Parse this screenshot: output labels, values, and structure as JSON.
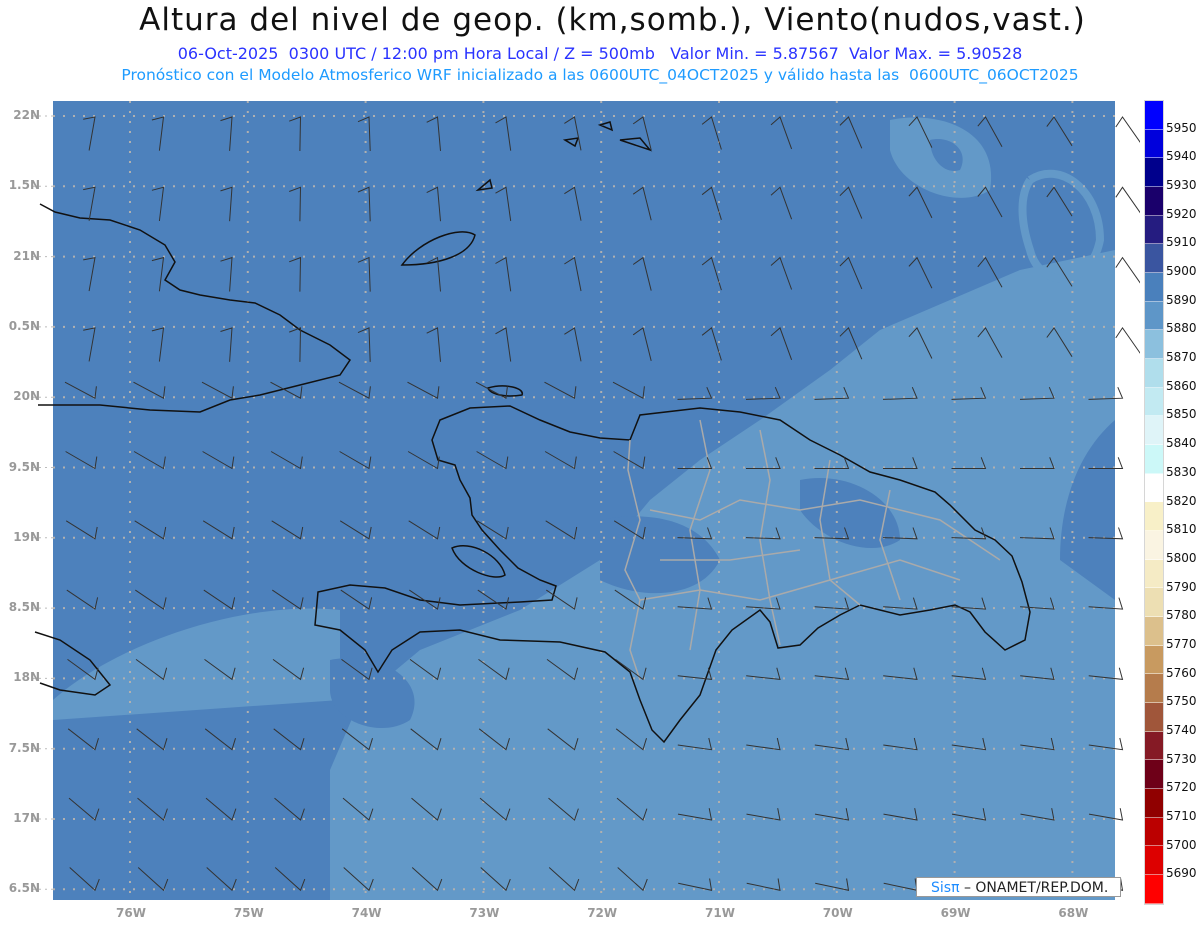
{
  "header": {
    "title": "Altura del nivel de geop. (km,somb.), Viento(nudos,vast.)",
    "line1": "06-Oct-2025  0300 UTC / 12:00 pm Hora Local / Z = 500mb   Valor Min. = 5.87567  Valor Max. = 5.90528",
    "line2": "Pronóstico con el Modelo Atmosferico WRF inicializado a las 0600UTC_04OCT2025 y válido hasta las  0600UTC_06OCT2025"
  },
  "axes": {
    "lat_labels": [
      "22N",
      "1.5N",
      "21N",
      "0.5N",
      "20N",
      "9.5N",
      "19N",
      "8.5N",
      "18N",
      "7.5N",
      "17N",
      "6.5N"
    ],
    "lon_labels": [
      "76W",
      "75W",
      "74W",
      "73W",
      "72W",
      "71W",
      "70W",
      "69W",
      "68W"
    ]
  },
  "colorbar": {
    "labels": [
      "5950",
      "5940",
      "5930",
      "5920",
      "5910",
      "5900",
      "5890",
      "5880",
      "5870",
      "5860",
      "5850",
      "5840",
      "5830",
      "5820",
      "5810",
      "5800",
      "5790",
      "5780",
      "5770",
      "5760",
      "5750",
      "5740",
      "5730",
      "5720",
      "5710",
      "5700",
      "5690"
    ],
    "colors": [
      "#0000ff",
      "#0000dc",
      "#00008c",
      "#1a006b",
      "#251c80",
      "#3a55a0",
      "#4a80bc",
      "#5e96c8",
      "#8cc0de",
      "#b0deec",
      "#c2eaf2",
      "#dff4f8",
      "#ccf8f8",
      "#ffffff",
      "#f8f0c8",
      "#faf4e2",
      "#f5ebc5",
      "#eddfb3",
      "#dcc08c",
      "#c89a60",
      "#b57c4c",
      "#a0563a",
      "#851a25",
      "#6e0018",
      "#900000",
      "#bb0000",
      "#dd0000",
      "#ff0000"
    ]
  },
  "field_colors": {
    "dark": "#4d81bc",
    "light": "#6399c8"
  },
  "credit": {
    "brand": "Sisπ",
    "text": " –  ONAMET/REP.DOM."
  }
}
